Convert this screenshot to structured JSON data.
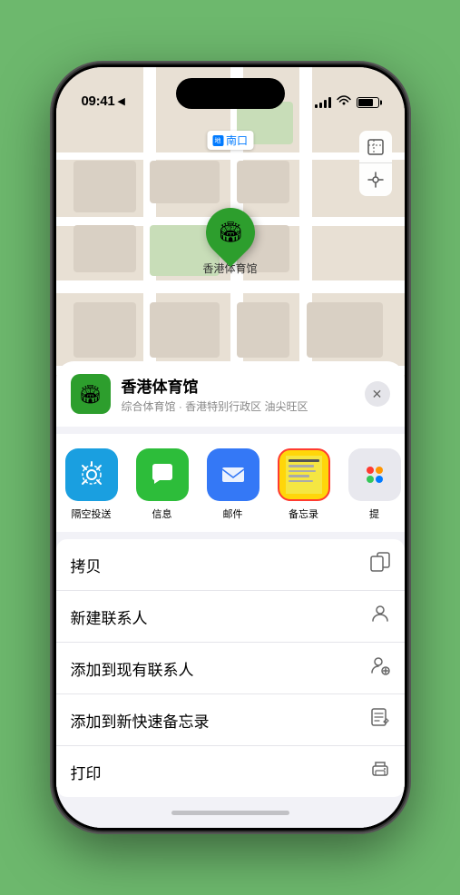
{
  "status_bar": {
    "time": "09:41",
    "location_arrow": "▶"
  },
  "map": {
    "location_label": "南口",
    "pin_label": "香港体育馆",
    "pin_emoji": "🏟"
  },
  "location_card": {
    "name": "香港体育馆",
    "address": "综合体育馆 · 香港特别行政区 油尖旺区",
    "close_label": "✕"
  },
  "share_items": [
    {
      "id": "airdrop",
      "label": "隔空投送",
      "icon": "📡"
    },
    {
      "id": "messages",
      "label": "信息",
      "icon": "💬"
    },
    {
      "id": "mail",
      "label": "邮件",
      "icon": "✉️"
    },
    {
      "id": "notes",
      "label": "备忘录",
      "icon": ""
    },
    {
      "id": "more",
      "label": "提",
      "icon": ""
    }
  ],
  "action_items": [
    {
      "id": "copy",
      "label": "拷贝",
      "icon": "⎘"
    },
    {
      "id": "new-contact",
      "label": "新建联系人",
      "icon": "👤"
    },
    {
      "id": "add-existing",
      "label": "添加到现有联系人",
      "icon": "👤+"
    },
    {
      "id": "add-note",
      "label": "添加到新快速备忘录",
      "icon": "🖊"
    },
    {
      "id": "print",
      "label": "打印",
      "icon": "🖨"
    }
  ]
}
